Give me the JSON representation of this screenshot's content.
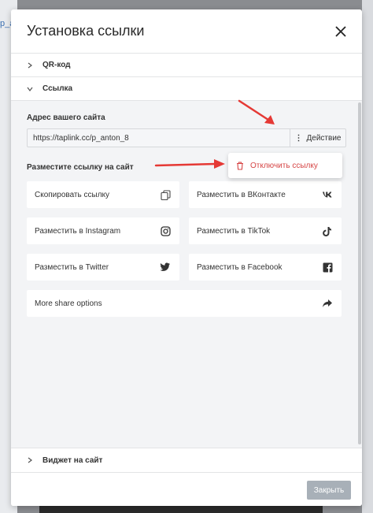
{
  "background": {
    "left_text": "p_an"
  },
  "modal": {
    "title": "Установка ссылки",
    "sections": {
      "qr": "QR-код",
      "link": "Ссылка",
      "widget": "Виджет на сайт"
    },
    "link": {
      "address_label": "Адрес вашего сайта",
      "url_value": "https://taplink.cc/p_anton_8",
      "action_label": "Действие",
      "dropdown_item": "Отключить ссылку",
      "share_label": "Разместите ссылку на сайт",
      "share_items": [
        {
          "label": "Скопировать ссылку",
          "icon": "copy-icon"
        },
        {
          "label": "Разместить в ВКонтакте",
          "icon": "vk-icon"
        },
        {
          "label": "Разместить в Instagram",
          "icon": "instagram-icon"
        },
        {
          "label": "Разместить в TikTok",
          "icon": "tiktok-icon"
        },
        {
          "label": "Разместить в Twitter",
          "icon": "twitter-icon"
        },
        {
          "label": "Разместить в Facebook",
          "icon": "facebook-icon"
        },
        {
          "label": "More share options",
          "icon": "share-icon"
        }
      ]
    },
    "footer": {
      "close_label": "Закрыть"
    }
  },
  "colors": {
    "danger": "#d64545",
    "annotation_arrow": "#e53935",
    "disabled_button": "#a8b0b8"
  }
}
